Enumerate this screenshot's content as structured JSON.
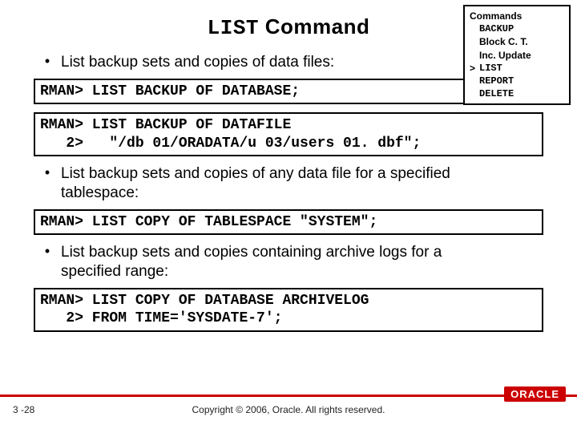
{
  "title_mono": "LIST",
  "title_rest": " Command",
  "topics": {
    "header": "Commands",
    "items": [
      {
        "mark": "",
        "label": "BACKUP",
        "mono": true
      },
      {
        "mark": "",
        "label": "Block C. T.",
        "mono": false
      },
      {
        "mark": "",
        "label": "Inc. Update",
        "mono": false
      },
      {
        "mark": ">",
        "label": "LIST",
        "mono": true
      },
      {
        "mark": "",
        "label": "REPORT",
        "mono": true
      },
      {
        "mark": "",
        "label": "DELETE",
        "mono": true
      }
    ]
  },
  "bullets": [
    "List backup sets and copies of data files:",
    "List backup sets and copies of any data file for a specified tablespace:",
    "List backup sets and copies containing archive logs for a specified range:"
  ],
  "code": [
    "RMAN> LIST BACKUP OF DATABASE;",
    "RMAN> LIST BACKUP OF DATAFILE\n   2>   \"/db 01/ORADATA/u 03/users 01. dbf\";",
    "RMAN> LIST COPY OF TABLESPACE \"SYSTEM\";",
    "RMAN> LIST COPY OF DATABASE ARCHIVELOG\n   2> FROM TIME='SYSDATE-7';"
  ],
  "footer": {
    "page": "3 -28",
    "copyright": "Copyright © 2006, Oracle. All rights reserved.",
    "logo": "ORACLE"
  }
}
